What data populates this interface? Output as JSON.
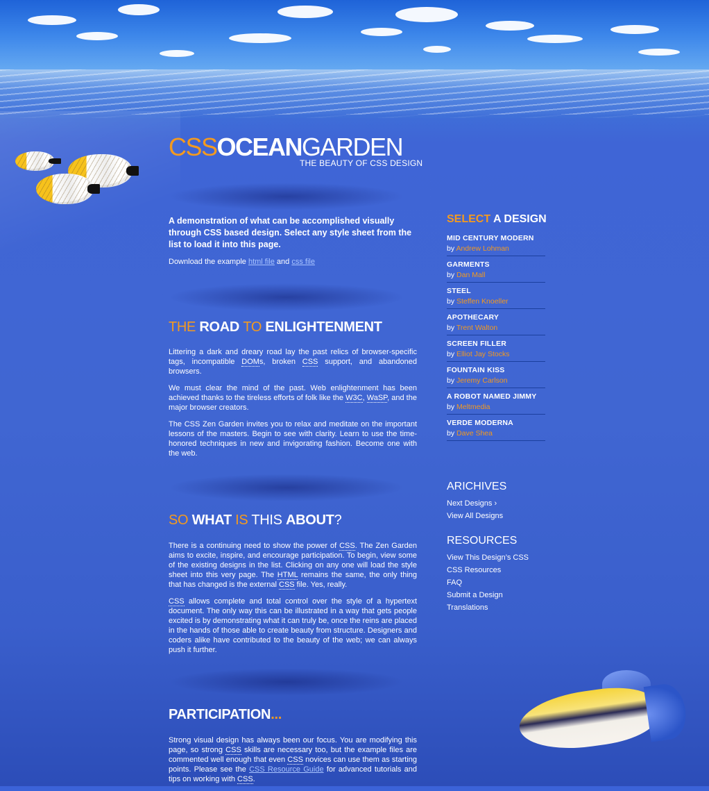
{
  "header": {
    "logo_part1": "CSS",
    "logo_part2": "OCEAN",
    "logo_part3": "GARDEN",
    "tagline": "THE BEAUTY OF CSS DESIGN"
  },
  "intro": {
    "text": "A demonstration of what can be accomplished visually through CSS based design.  Select any style sheet from the list to load it into this page.",
    "download_prefix": "Download the example ",
    "html_link": "html file",
    "and": " and ",
    "css_link": "css file"
  },
  "section_road": {
    "t1": "THE ",
    "t2": "ROAD ",
    "t3": "TO ",
    "t4": "ENLIGHTENMENT",
    "p1a": "Littering a dark and dreary road lay the past relics of browser-specific tags, incompatible ",
    "p1b": "DOM",
    "p1c": "s, broken ",
    "p1d": "CSS",
    "p1e": " support, and abandoned browsers.",
    "p2a": "We must clear the mind of the past. Web enlightenment has been achieved thanks to the tireless efforts of folk like the ",
    "p2b": "W3C",
    "p2c": ", ",
    "p2d": "WaSP",
    "p2e": ", and the major browser creators.",
    "p3": "The CSS Zen Garden invites you to relax and meditate on the important lessons of the masters. Begin to see with clarity. Learn to use the time-honored techniques in new and invigorating fashion. Become one with the web."
  },
  "section_what": {
    "t1": "SO ",
    "t2": "WHAT ",
    "t3": "IS ",
    "t4": "THIS ",
    "t5": "ABOUT",
    "t6": "?",
    "p1a": "There is a continuing need to show the power of ",
    "p1b": "CSS",
    "p1c": ". The Zen Garden aims to excite, inspire, and encourage participation. To begin, view some of the existing designs in the list. Clicking on any one will load the style sheet into this very page. The ",
    "p1d": "HTML",
    "p1e": " remains the same, the only thing that has changed is the external ",
    "p1f": "CSS",
    "p1g": " file. Yes, really.",
    "p2a": "CSS",
    "p2b": " allows complete and total control over the style of a hypertext document. The only way this can be illustrated in a way that gets people excited is by demonstrating what it can truly be, once the reins are placed in the hands of those able to create beauty from structure. Designers and coders alike have contributed to the beauty of the web; we can always push it further."
  },
  "section_participation": {
    "t1": "PARTICIPATION",
    "t2": "...",
    "p1a": "Strong visual design has always been our focus. You are modifying this page, so strong ",
    "p1b": "CSS",
    "p1c": " skills are necessary too, but the example files are commented well enough that even ",
    "p1d": "CSS",
    "p1e": " novices can use them as starting points. Please see the ",
    "p1link": "CSS Resource Guide",
    "p1f": " for advanced tutorials and tips on working with ",
    "p1g": "CSS",
    "p1h": "."
  },
  "sidebar": {
    "select_1": "SELECT",
    "select_2": " A ",
    "select_3": "DESIGN",
    "by_label": "by ",
    "designs": [
      {
        "name": "MID CENTURY MODERN",
        "author": "Andrew Lohman"
      },
      {
        "name": "GARMENTS",
        "author": "Dan Mall"
      },
      {
        "name": "STEEL",
        "author": "Steffen Knoeller"
      },
      {
        "name": "APOTHECARY",
        "author": "Trent Walton"
      },
      {
        "name": "SCREEN FILLER",
        "author": "Elliot Jay Stocks"
      },
      {
        "name": "FOUNTAIN KISS",
        "author": "Jeremy Carlson"
      },
      {
        "name": "A ROBOT NAMED JIMMY",
        "author": "Meltmedia"
      },
      {
        "name": "VERDE MODERNA",
        "author": "Dave Shea"
      }
    ],
    "archives_title": "ARICHIVES",
    "archives": [
      "Next Designs ›",
      "View All Designs"
    ],
    "resources_title": "RESOURCES",
    "resources": [
      "View This Design’s CSS",
      "CSS Resources",
      "FAQ",
      "Submit a Design",
      "Translations"
    ]
  },
  "colors": {
    "accent": "#f49a1f",
    "background": "#4066d2",
    "link": "#a9c4ff"
  },
  "icons": [
    "butterflyfish-icon",
    "triggerfish-icon"
  ]
}
